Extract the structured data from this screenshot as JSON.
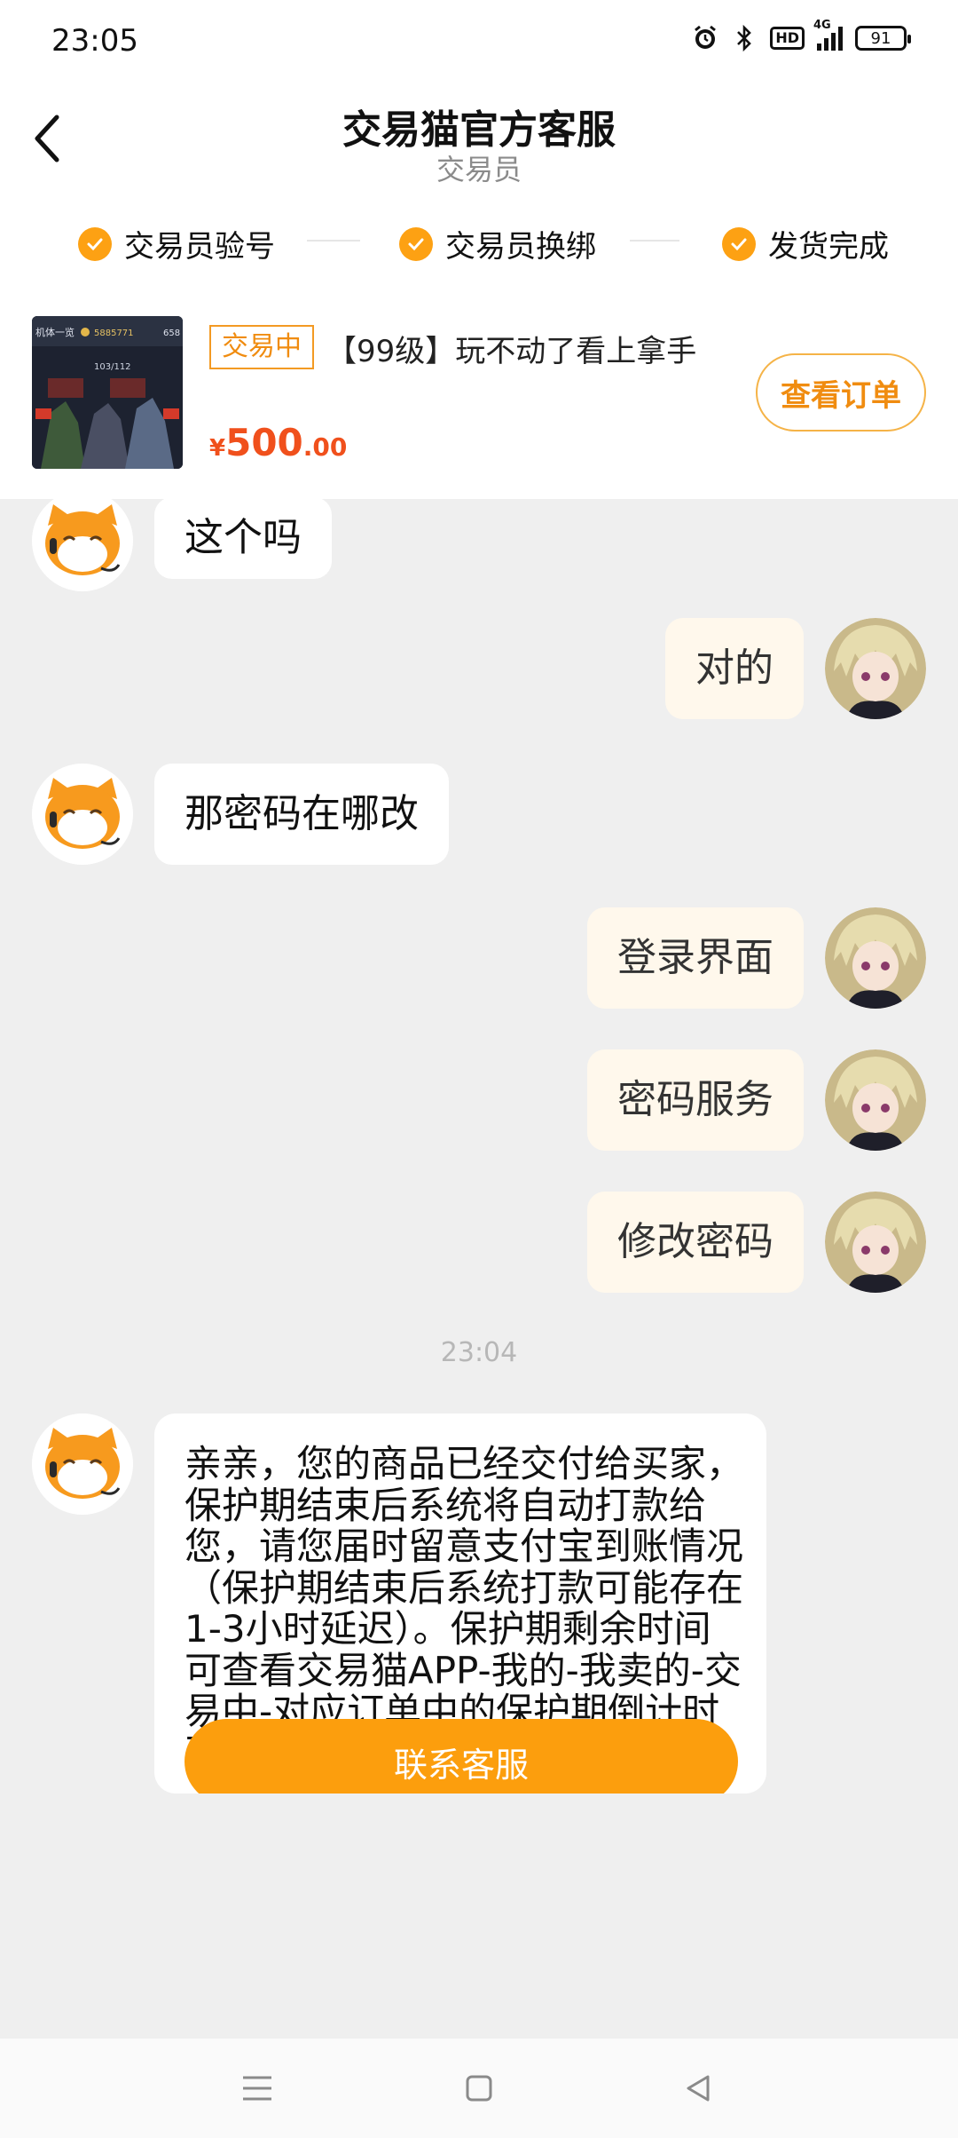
{
  "status_bar": {
    "time": "23:05",
    "battery": "91",
    "network": "4G",
    "hd": "HD"
  },
  "header": {
    "title": "交易猫官方客服",
    "subtitle": "交易员"
  },
  "steps": [
    {
      "label": "交易员验号"
    },
    {
      "label": "交易员换绑"
    },
    {
      "label": "发货完成"
    }
  ],
  "product": {
    "status_tag": "交易中",
    "title": "【99级】玩不动了看上拿手",
    "price_symbol": "¥",
    "price_int": "500",
    "price_dec": ".00",
    "view_order_label": "查看订单",
    "thumb_text": {
      "top": "机体一览",
      "count": "5885771",
      "sub": "103/112",
      "corner": "658"
    }
  },
  "messages": [
    {
      "side": "left",
      "text": "这个吗"
    },
    {
      "side": "right",
      "text": "对的"
    },
    {
      "side": "left",
      "text": "那密码在哪改"
    },
    {
      "side": "right",
      "text": "登录界面"
    },
    {
      "side": "right",
      "text": "密码服务"
    },
    {
      "side": "right",
      "text": "修改密码"
    }
  ],
  "timestamp": "23:04",
  "service_message": {
    "text": "亲亲，您的商品已经交付给买家，保护期结束后系统将自动打款给您，请您届时留意支付宝到账情况（保护期结束后系统打款可能存在1-3小时延迟）。保护期剩余时间可查看交易猫APP-我的-我卖的-交易中-对应订单中的保护期倒计时页面。",
    "button_label": "联系客服"
  },
  "colors": {
    "accent": "#fc9e0d",
    "price": "#f0501c",
    "tag": "#f08c10",
    "right_bubble": "#fff8ec",
    "chat_bg": "#efefef"
  }
}
